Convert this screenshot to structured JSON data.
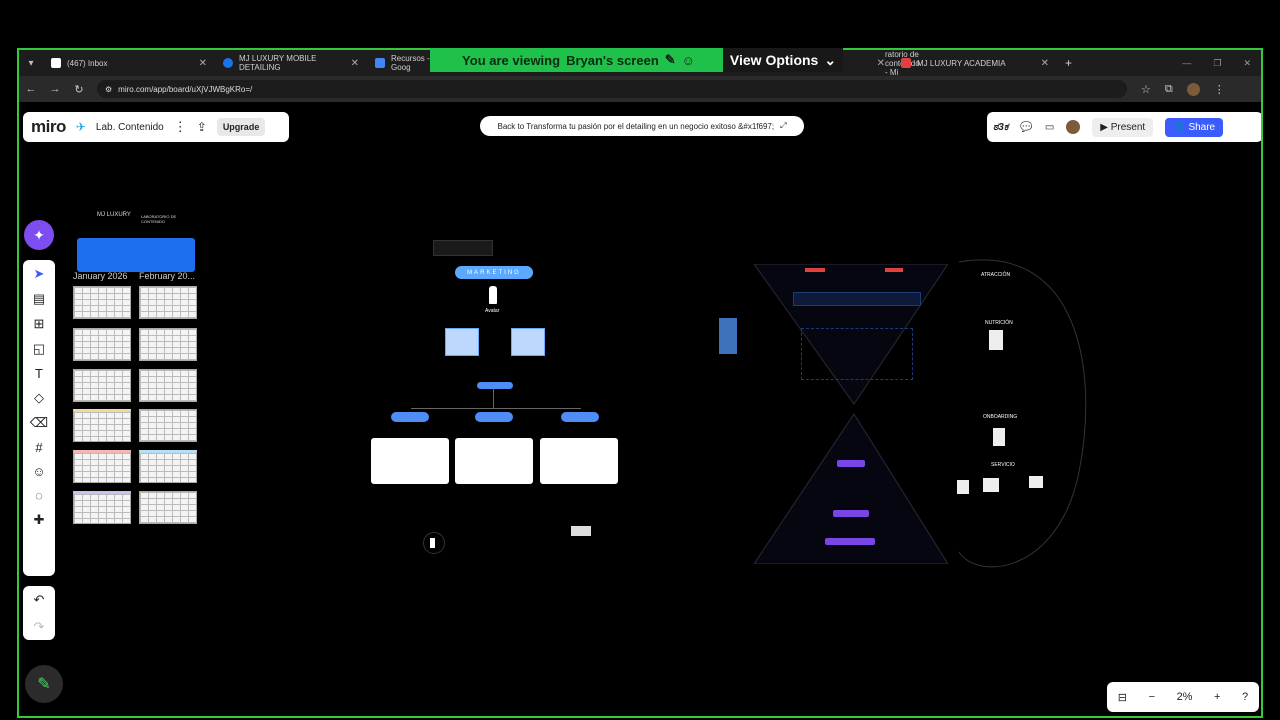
{
  "share": {
    "viewing_text": "You are viewing",
    "presenter": "Bryan's screen",
    "view_options": "View Options"
  },
  "tabs": [
    {
      "label": "(467) Inbox",
      "color": "#ffffff"
    },
    {
      "label": "MJ LUXURY MOBILE DETAILING",
      "color": "#1a73e8"
    },
    {
      "label": "Recursos - Goog",
      "color": "#4285f4"
    },
    {
      "label": "ratorio de contenido - Mi",
      "color": "#f5c518"
    },
    {
      "label": "MJ LUXURY ACADEMIA",
      "color": "#e04040"
    }
  ],
  "address": {
    "url": "miro.com/app/board/uXjVJWBgKRo=/"
  },
  "miro": {
    "logo": "miro",
    "board_name": "Lab. Contenido",
    "upgrade": "Upgrade",
    "back_label": "Back to Transforma tu pasión por el detailing en un negocio exitoso &#x1f697;",
    "present": "Present",
    "share": "Share",
    "zoom": "2%"
  },
  "board": {
    "brand": "MJ LUXURY",
    "brand_sub": "LABORATORIO DE CONTENIDO",
    "cal_month_1": "January 2026",
    "cal_month_2": "February 20...",
    "marketing": "MARKETING",
    "avatar_label": "Avatar",
    "onboarding": "ONBOARDING",
    "servicio": "SERVICIO",
    "atraccion": "ATRACCIÓN",
    "nutricion": "NUTRICIÓN"
  }
}
